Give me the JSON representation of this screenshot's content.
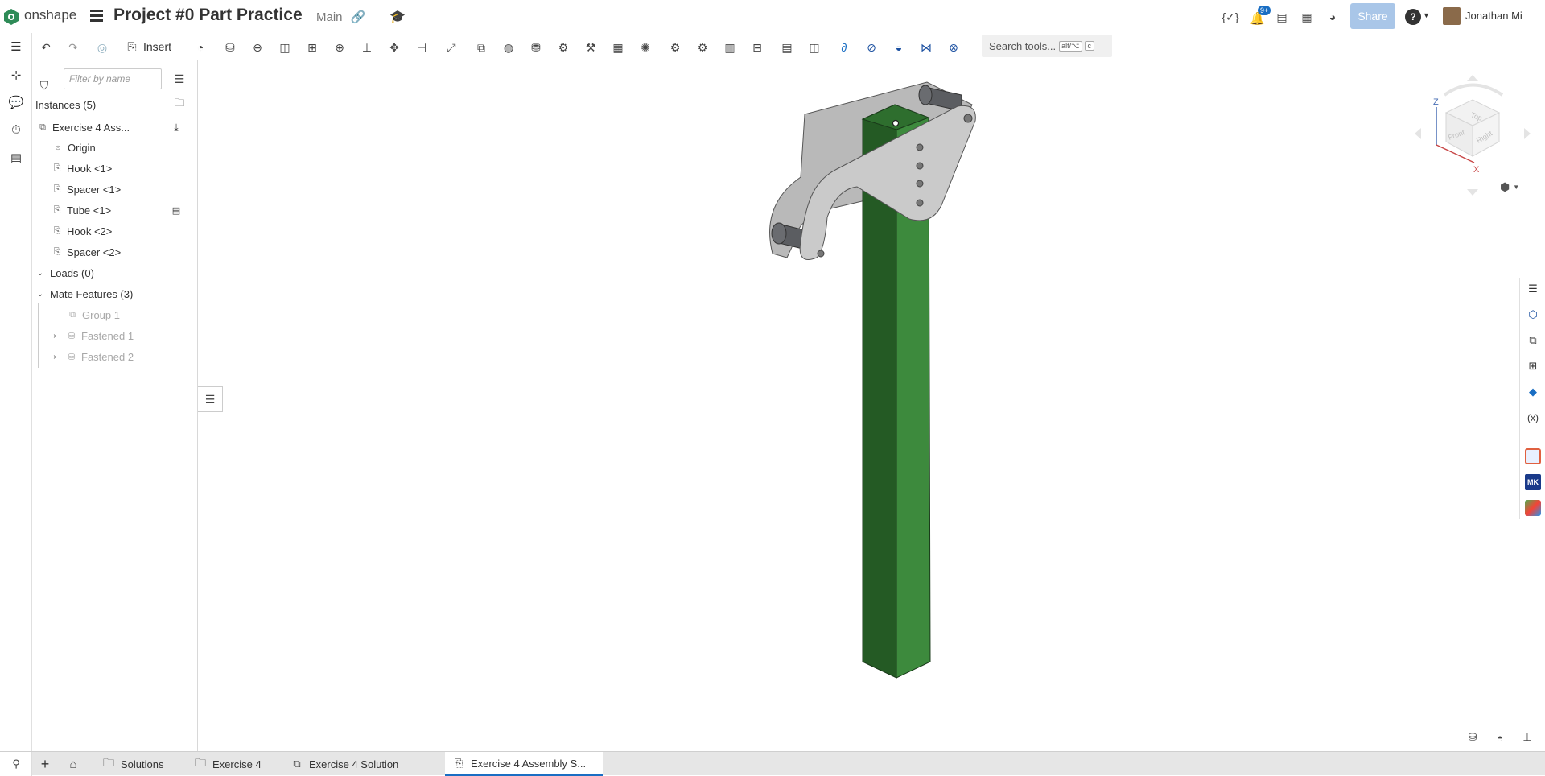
{
  "header": {
    "brand": "onshape",
    "document_title": "Project #0 Part Practice",
    "branch": "Main",
    "notification_count": "9+",
    "share_label": "Share",
    "user_name": "Jonathan Mi"
  },
  "toolbar": {
    "insert_label": "Insert",
    "search_label": "Search tools...",
    "search_kbd_1": "alt/⌥",
    "search_kbd_2": "c"
  },
  "panel": {
    "filter_placeholder": "Filter by name",
    "instances_label": "Instances (5)",
    "items": [
      {
        "label": "Exercise 4 Ass..."
      },
      {
        "label": "Origin"
      },
      {
        "label": "Hook <1>"
      },
      {
        "label": "Spacer <1>"
      },
      {
        "label": "Tube <1>"
      },
      {
        "label": "Hook <2>"
      },
      {
        "label": "Spacer <2>"
      }
    ],
    "loads_label": "Loads (0)",
    "mate_features_label": "Mate Features (3)",
    "mates": [
      {
        "label": "Group 1"
      },
      {
        "label": "Fastened 1"
      },
      {
        "label": "Fastened 2"
      }
    ]
  },
  "viewcube": {
    "axis_z": "Z",
    "axis_x": "X",
    "face_top": "Top",
    "face_front": "Front",
    "face_right": "Right"
  },
  "tabs": [
    {
      "label": "Solutions"
    },
    {
      "label": "Exercise 4"
    },
    {
      "label": "Exercise 4 Solution"
    },
    {
      "label": "Exercise 4 Assembly S..."
    }
  ],
  "colors": {
    "accent": "#1a6ec3",
    "tube_light": "#3d8a3d",
    "tube_dark": "#245a24",
    "hook_gray": "#c9c9c9"
  }
}
